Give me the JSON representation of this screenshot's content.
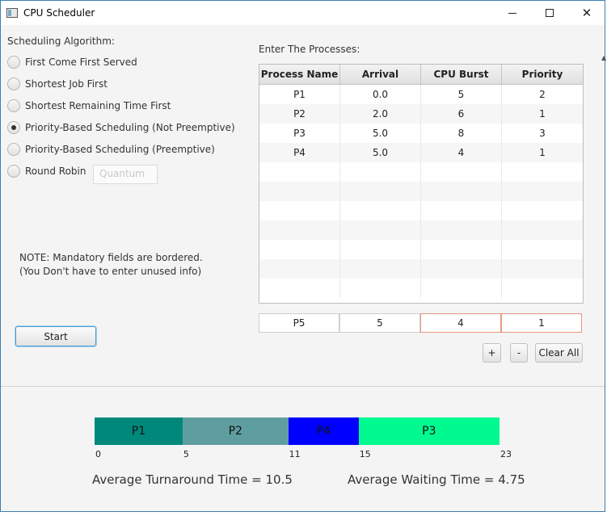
{
  "window": {
    "title": "CPU Scheduler"
  },
  "left": {
    "algorithm_label": "Scheduling Algorithm:",
    "options": [
      {
        "label": "First Come First Served",
        "checked": false
      },
      {
        "label": "Shortest Job First",
        "checked": false
      },
      {
        "label": "Shortest Remaining Time First",
        "checked": false
      },
      {
        "label": "Priority-Based Scheduling (Not Preemptive)",
        "checked": true
      },
      {
        "label": "Priority-Based Scheduling (Preemptive)",
        "checked": false
      },
      {
        "label": "Round Robin",
        "checked": false
      }
    ],
    "quantum_placeholder": "Quantum",
    "note_line1": "NOTE: Mandatory fields are bordered.",
    "note_line2": "(You Don't have to enter unused info)",
    "start_label": "Start"
  },
  "processes": {
    "label": "Enter The Processes:",
    "headers": [
      "Process Name",
      "Arrival",
      "CPU Burst",
      "Priority"
    ],
    "rows": [
      [
        "P1",
        "0.0",
        "5",
        "2"
      ],
      [
        "P2",
        "2.0",
        "6",
        "1"
      ],
      [
        "P3",
        "5.0",
        "8",
        "3"
      ],
      [
        "P4",
        "5.0",
        "4",
        "1"
      ]
    ],
    "inputs": {
      "name": "P5",
      "arrival": "5",
      "burst": "4",
      "priority": "1"
    },
    "add_label": "+",
    "remove_label": "-",
    "clear_label": "Clear All"
  },
  "gantt": {
    "blocks": [
      {
        "label": "P1",
        "start": 0,
        "end": 5,
        "color": "#00897b"
      },
      {
        "label": "P2",
        "start": 5,
        "end": 11,
        "color": "#5f9ea0"
      },
      {
        "label": "P4",
        "start": 11,
        "end": 15,
        "color": "#0000ff"
      },
      {
        "label": "P3",
        "start": 15,
        "end": 23,
        "color": "#00fa8f"
      }
    ],
    "ticks": [
      "0",
      "5",
      "11",
      "15",
      "23"
    ],
    "avg_turnaround": "Average Turnaround Time = 10.5",
    "avg_waiting": "Average Waiting Time = 4.75"
  }
}
